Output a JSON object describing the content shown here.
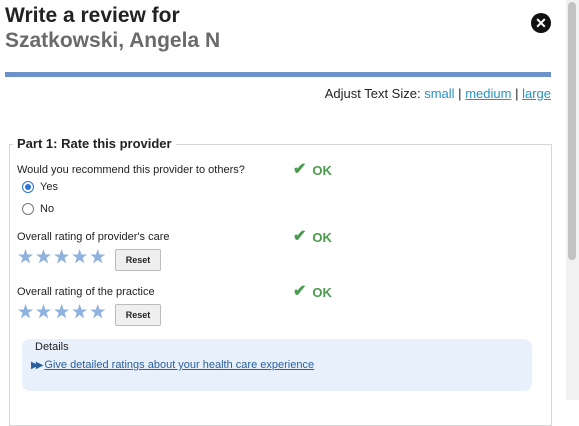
{
  "dialog": {
    "title_line1": "Write a review for",
    "title_line2": "Szatkowski, Angela N",
    "close_icon": "close-icon"
  },
  "text_size": {
    "label": "Adjust Text Size:",
    "options": [
      "small",
      "medium",
      "large"
    ],
    "selected": "small",
    "separator": "|"
  },
  "part1": {
    "legend": "Part 1: Rate this provider",
    "recommend": {
      "question": "Would you recommend this provider to others?",
      "status": "OK",
      "options": [
        "Yes",
        "No"
      ],
      "selected": "Yes"
    },
    "provider_care": {
      "question": "Overall rating of provider's care",
      "status": "OK",
      "rating": 5,
      "max": 5,
      "reset_label": "Reset"
    },
    "practice": {
      "question": "Overall rating of the practice",
      "status": "OK",
      "rating": 5,
      "max": 5,
      "reset_label": "Reset"
    },
    "details": {
      "label": "Details",
      "link": "Give detailed ratings about your health care experience"
    }
  },
  "colors": {
    "accent_rule": "#6b93c9",
    "link": "#2a91c5",
    "ok_green": "#4a9b4e",
    "star": "#8fb2df",
    "details_bg": "#e8f1fb"
  }
}
